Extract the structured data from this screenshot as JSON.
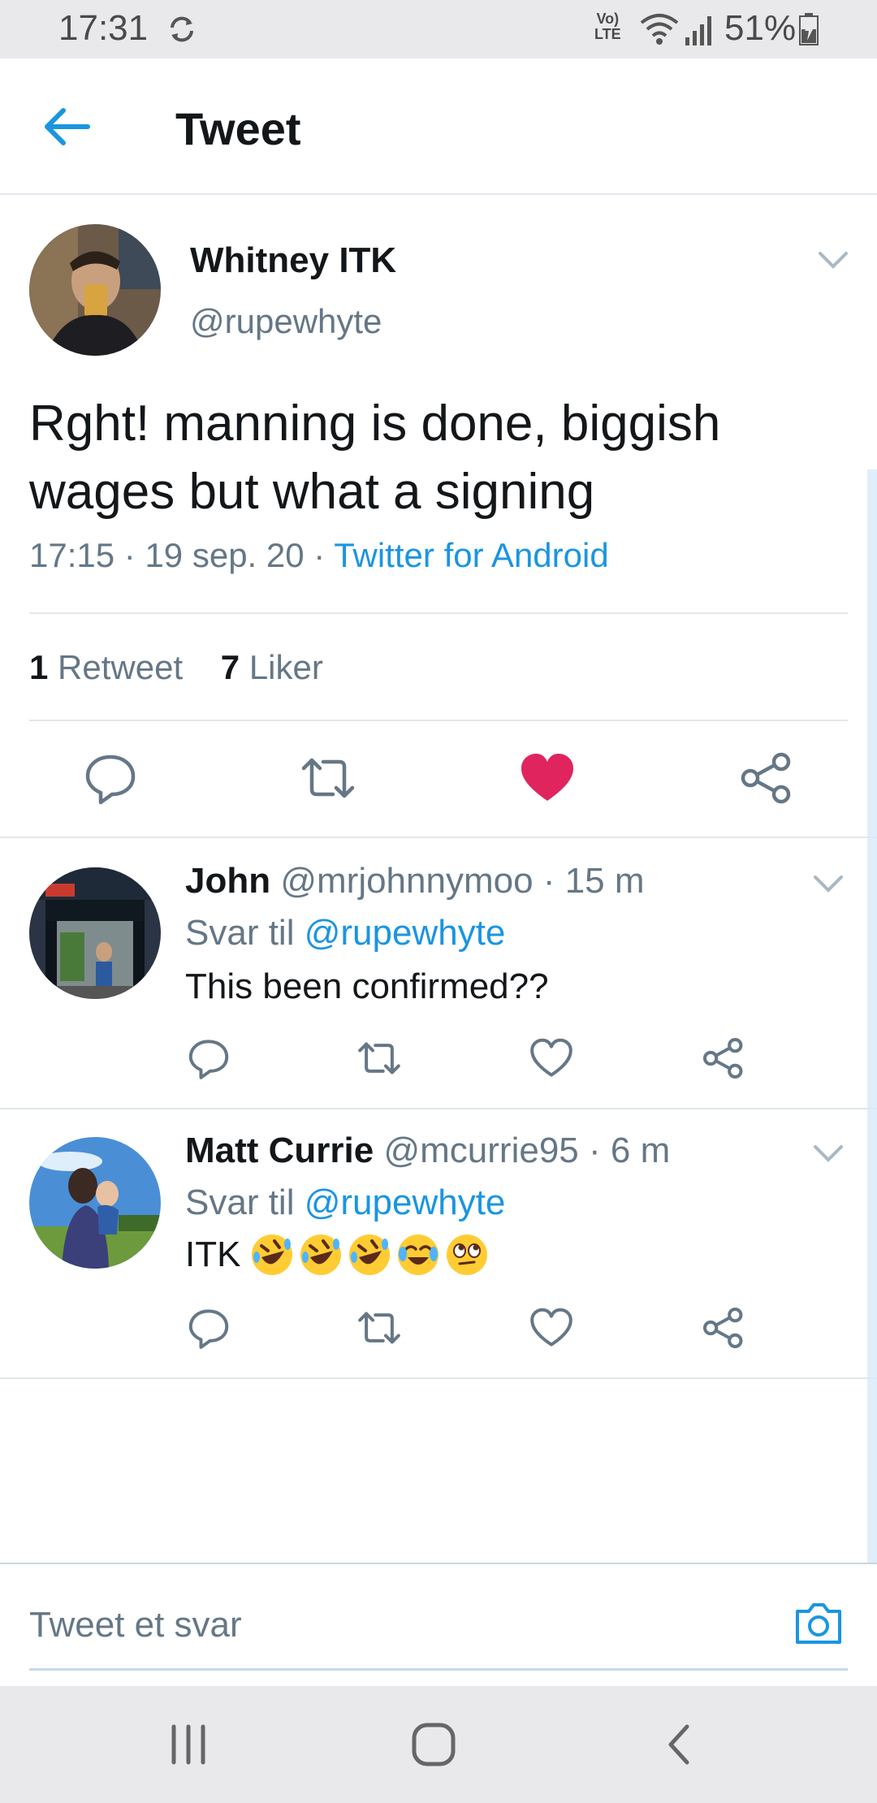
{
  "status_bar": {
    "time": "17:31",
    "volte_line1": "Vo)",
    "volte_line2": "LTE",
    "battery_percent": "51%"
  },
  "header": {
    "title": "Tweet",
    "back_icon": "arrow-left-icon"
  },
  "main_tweet": {
    "author_name": "Whitney ITK",
    "author_handle": "@rupewhyte",
    "text": "Rght! manning is done, biggish wages but what a signing",
    "time": "17:15",
    "date": "19 sep. 20",
    "sep": "·",
    "source": "Twitter for Android",
    "retweets_count": "1",
    "retweets_label": "Retweet",
    "likes_count": "7",
    "likes_label": "Liker",
    "liked": true
  },
  "replies": [
    {
      "name": "John",
      "handle": "@mrjohnnymoo",
      "age": "15 m",
      "reply_prefix": "Svar til",
      "reply_to": "@rupewhyte",
      "text": "This been confirmed??"
    },
    {
      "name": "Matt Currie",
      "handle": "@mcurrie95",
      "age": "6 m",
      "reply_prefix": "Svar til",
      "reply_to": "@rupewhyte",
      "text": "ITK",
      "emojis": [
        "rolling-on-floor-laughing-emoji",
        "rolling-on-floor-laughing-emoji",
        "rolling-on-floor-laughing-emoji",
        "tears-of-joy-emoji",
        "eye-roll-emoji"
      ]
    }
  ],
  "compose": {
    "placeholder": "Tweet et svar"
  },
  "colors": {
    "accent": "#1b95e0",
    "like": "#e0245e",
    "text": "#14171a",
    "secondary": "#657786"
  }
}
